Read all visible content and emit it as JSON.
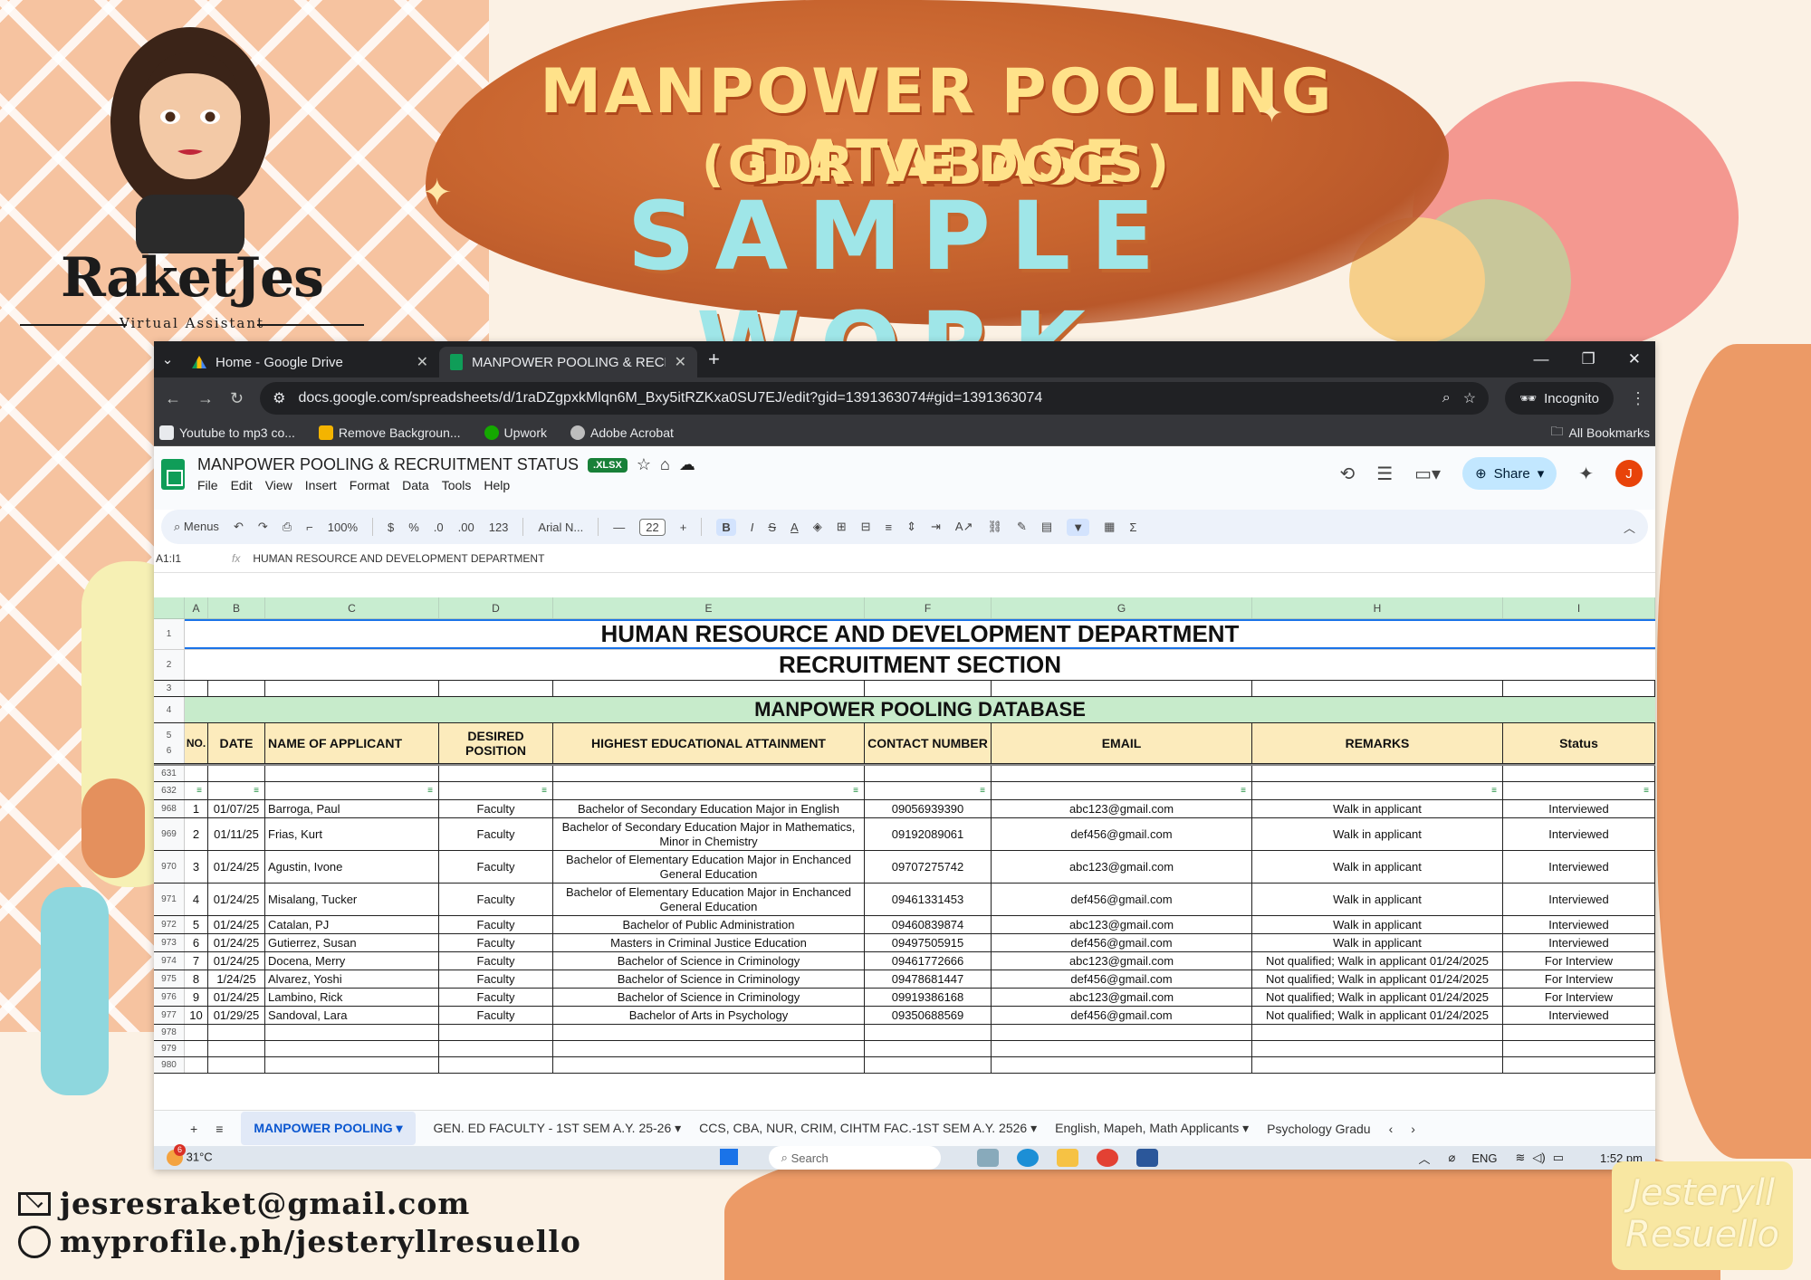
{
  "poster": {
    "title_line1": "MANPOWER POOLING DATABASE",
    "title_line2": "(GDRIVE DOCS)",
    "title_line3": "SAMPLE WORK",
    "brand": "RaketJes",
    "brand_sub": "Virtual Assistant",
    "email": "jesresraket@gmail.com",
    "profile": "myprofile.ph/jesteryllresuello",
    "signature_line1": "Jesteryll",
    "signature_line2": "Resuello"
  },
  "browser": {
    "tabs": [
      {
        "label": "Home - Google Drive",
        "icon": "google-drive-icon"
      },
      {
        "label": "MANPOWER POOLING & RECR",
        "icon": "sheets-icon"
      }
    ],
    "url": "docs.google.com/spreadsheets/d/1raDZgpxkMlqn6M_Bxy5itRZKxa0SU7EJ/edit?gid=1391363074#gid=1391363074",
    "incognito": "Incognito",
    "bookmarks": [
      "Youtube to mp3 co...",
      "Remove Backgroun...",
      "Upwork",
      "Adobe Acrobat"
    ],
    "all_bookmarks": "All Bookmarks"
  },
  "doc": {
    "title": "MANPOWER POOLING & RECRUITMENT STATUS",
    "badge": ".XLSX",
    "menus": [
      "File",
      "Edit",
      "View",
      "Insert",
      "Format",
      "Data",
      "Tools",
      "Help"
    ],
    "share": "Share",
    "user_initial": "J"
  },
  "toolbar": {
    "menus_label": "Menus",
    "zoom": "100%",
    "currency": "$",
    "percent": "%",
    "dec_down": ".0",
    "dec_up": ".00",
    "number_fmt": "123",
    "font": "Arial N...",
    "font_size": "22"
  },
  "formula": {
    "ref": "A1:I1",
    "value": "HUMAN RESOURCE AND DEVELOPMENT DEPARTMENT"
  },
  "sheet": {
    "columns": [
      "A",
      "B",
      "C",
      "D",
      "E",
      "F",
      "G",
      "H",
      "I"
    ],
    "dept": "HUMAN RESOURCE AND DEVELOPMENT DEPARTMENT",
    "section": "RECRUITMENT SECTION",
    "db_title": "MANPOWER POOLING DATABASE",
    "headers": {
      "no": "NO.",
      "date": "DATE",
      "name": "NAME OF APPLICANT",
      "position": "DESIRED POSITION",
      "education": "HIGHEST EDUCATIONAL ATTAINMENT",
      "contact": "CONTACT NUMBER",
      "email": "EMAIL",
      "remarks": "REMARKS",
      "status": "Status"
    },
    "header_row_nums": [
      "1",
      "2",
      "3",
      "4",
      "5",
      "6",
      "631",
      "632"
    ],
    "rows": [
      {
        "rn": "968",
        "no": "1",
        "date": "01/07/25",
        "name": "Barroga, Paul",
        "position": "Faculty",
        "education": "Bachelor of Secondary Education Major in English",
        "contact": "09056939390",
        "email": "abc123@gmail.com",
        "remarks": "Walk in applicant",
        "status": "Interviewed"
      },
      {
        "rn": "969",
        "no": "2",
        "date": "01/11/25",
        "name": "Frias, Kurt",
        "position": "Faculty",
        "education": "Bachelor of Secondary Education Major in Mathematics, Minor in Chemistry",
        "contact": "09192089061",
        "email": "def456@gmail.com",
        "remarks": "Walk in applicant",
        "status": "Interviewed"
      },
      {
        "rn": "970",
        "no": "3",
        "date": "01/24/25",
        "name": "Agustin, Ivone",
        "position": "Faculty",
        "education": "Bachelor of Elementary Education Major in Enchanced General Education",
        "contact": "09707275742",
        "email": "abc123@gmail.com",
        "remarks": "Walk in applicant",
        "status": "Interviewed"
      },
      {
        "rn": "971",
        "no": "4",
        "date": "01/24/25",
        "name": "Misalang, Tucker",
        "position": "Faculty",
        "education": "Bachelor of Elementary Education Major in Enchanced General Education",
        "contact": "09461331453",
        "email": "def456@gmail.com",
        "remarks": "Walk in applicant",
        "status": "Interviewed"
      },
      {
        "rn": "972",
        "no": "5",
        "date": "01/24/25",
        "name": "Catalan, PJ",
        "position": "Faculty",
        "education": "Bachelor of Public Administration",
        "contact": "09460839874",
        "email": "abc123@gmail.com",
        "remarks": "Walk in applicant",
        "status": "Interviewed"
      },
      {
        "rn": "973",
        "no": "6",
        "date": "01/24/25",
        "name": "Gutierrez, Susan",
        "position": "Faculty",
        "education": "Masters in Criminal Justice Education",
        "contact": "09497505915",
        "email": "def456@gmail.com",
        "remarks": "Walk in applicant",
        "status": "Interviewed"
      },
      {
        "rn": "974",
        "no": "7",
        "date": "01/24/25",
        "name": "Docena, Merry",
        "position": "Faculty",
        "education": "Bachelor of Science in Criminology",
        "contact": "09461772666",
        "email": "abc123@gmail.com",
        "remarks": "Not qualified; Walk in applicant 01/24/2025",
        "status": "For Interview"
      },
      {
        "rn": "975",
        "no": "8",
        "date": "1/24/25",
        "name": "Alvarez, Yoshi",
        "position": "Faculty",
        "education": "Bachelor of Science in Criminology",
        "contact": "09478681447",
        "email": "def456@gmail.com",
        "remarks": "Not qualified; Walk in applicant 01/24/2025",
        "status": "For Interview"
      },
      {
        "rn": "976",
        "no": "9",
        "date": "01/24/25",
        "name": "Lambino, Rick",
        "position": "Faculty",
        "education": "Bachelor of Science in Criminology",
        "contact": "09919386168",
        "email": "abc123@gmail.com",
        "remarks": "Not qualified; Walk in applicant 01/24/2025",
        "status": "For Interview"
      },
      {
        "rn": "977",
        "no": "10",
        "date": "01/29/25",
        "name": "Sandoval, Lara",
        "position": "Faculty",
        "education": "Bachelor of Arts in Psychology",
        "contact": "09350688569",
        "email": "def456@gmail.com",
        "remarks": "Not qualified; Walk in applicant 01/24/2025",
        "status": "Interviewed"
      }
    ],
    "empty_rows": [
      "978",
      "979",
      "980"
    ]
  },
  "sheet_tabs": [
    "MANPOWER POOLING",
    "GEN. ED FACULTY - 1ST SEM A.Y. 25-26",
    "CCS, CBA, NUR, CRIM, CIHTM FAC.-1ST SEM A.Y. 2526",
    "English, Mapeh, Math Applicants",
    "Psychology Gradu"
  ],
  "taskbar": {
    "weather": "31°C",
    "weather_badge": "6",
    "search": "Search",
    "lang": "ENG",
    "time": "1:52 pm"
  }
}
